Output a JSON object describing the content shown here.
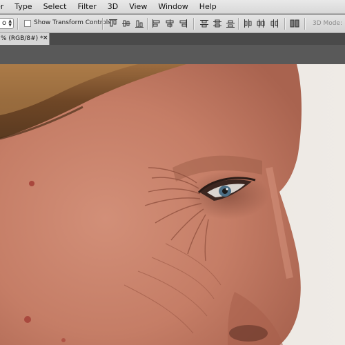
{
  "menu": {
    "items": [
      "er",
      "Type",
      "Select",
      "Filter",
      "3D",
      "View",
      "Window",
      "Help"
    ]
  },
  "options": {
    "dropdown_value": "o",
    "show_transform_label": "Show Transform Controls",
    "show_transform_checked": false,
    "mode_3d_label": "3D Mode:"
  },
  "document": {
    "tab_label": "% (RGB/8#) *",
    "close_glyph": "×"
  },
  "colors": {
    "background": "#ece8e3",
    "skin": "#c9806a",
    "hair": "#7a5230"
  },
  "icons": [
    "align-top-edges-icon",
    "align-vertical-centers-icon",
    "align-bottom-edges-icon",
    "align-left-edges-icon",
    "align-horizontal-centers-icon",
    "align-right-edges-icon",
    "distribute-top-edges-icon",
    "distribute-vertical-centers-icon",
    "distribute-bottom-edges-icon",
    "distribute-left-edges-icon",
    "distribute-horizontal-centers-icon",
    "distribute-right-edges-icon",
    "auto-align-layers-icon"
  ]
}
